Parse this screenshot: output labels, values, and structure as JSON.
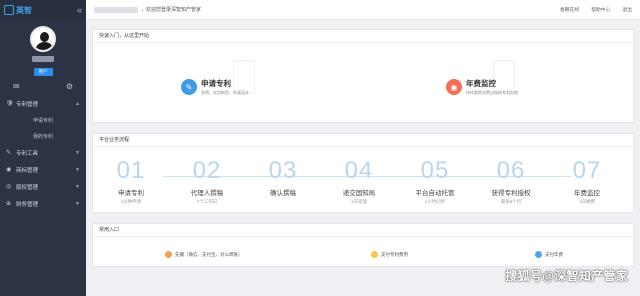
{
  "app": {
    "logo_text": "英智"
  },
  "header": {
    "welcome": "，欢迎您登录深智知产管家",
    "links": [
      "春眠在线",
      "帮助中心",
      "退出"
    ]
  },
  "sidebar": {
    "badge": "用户",
    "menu": [
      {
        "label": "专利管理",
        "icon": "🛡",
        "sub": [
          "申请专利",
          "我的专利"
        ]
      },
      {
        "label": "专利工具",
        "icon": "✎",
        "sub": []
      },
      {
        "label": "商标管理",
        "icon": "◉",
        "sub": []
      },
      {
        "label": "版权管理",
        "icon": "◎",
        "sub": []
      },
      {
        "label": "财务管理",
        "icon": "⊕",
        "sub": []
      }
    ]
  },
  "quick": {
    "title": "快速入门，从这里开始",
    "items": [
      {
        "title": "申请专利",
        "sub": "发明、实用新型、外观设计",
        "color": "#3e9be8"
      },
      {
        "title": "年费监控",
        "sub": "持续跟踪年费以保持专利生效",
        "color": "#f26f5c"
      }
    ]
  },
  "process": {
    "title": "平台业务流程",
    "steps": [
      {
        "num": "01",
        "name": "申请专利",
        "dur": "1分钟申请"
      },
      {
        "num": "02",
        "name": "代理人撰稿",
        "dur": "7个工作日"
      },
      {
        "num": "03",
        "name": "确认撰稿",
        "dur": ""
      },
      {
        "num": "04",
        "name": "递交国知局",
        "dur": "1日受理"
      },
      {
        "num": "05",
        "name": "平台自动托管",
        "dur": "1小时同步"
      },
      {
        "num": "06",
        "name": "获得专利授权",
        "dur": "最快6个月"
      },
      {
        "num": "07",
        "name": "年费监控",
        "dur": "1日缴费"
      }
    ]
  },
  "common": {
    "title": "常用入口",
    "items": [
      {
        "label": "先撮（微信、支付宝、对公转账）",
        "color": "#f0a34a"
      },
      {
        "label": "支付专利费用",
        "color": "#f4c84a"
      },
      {
        "label": "支付年费",
        "color": "#4aa6f0"
      }
    ]
  },
  "footer_mark": "搜狐号@深智知产管家"
}
